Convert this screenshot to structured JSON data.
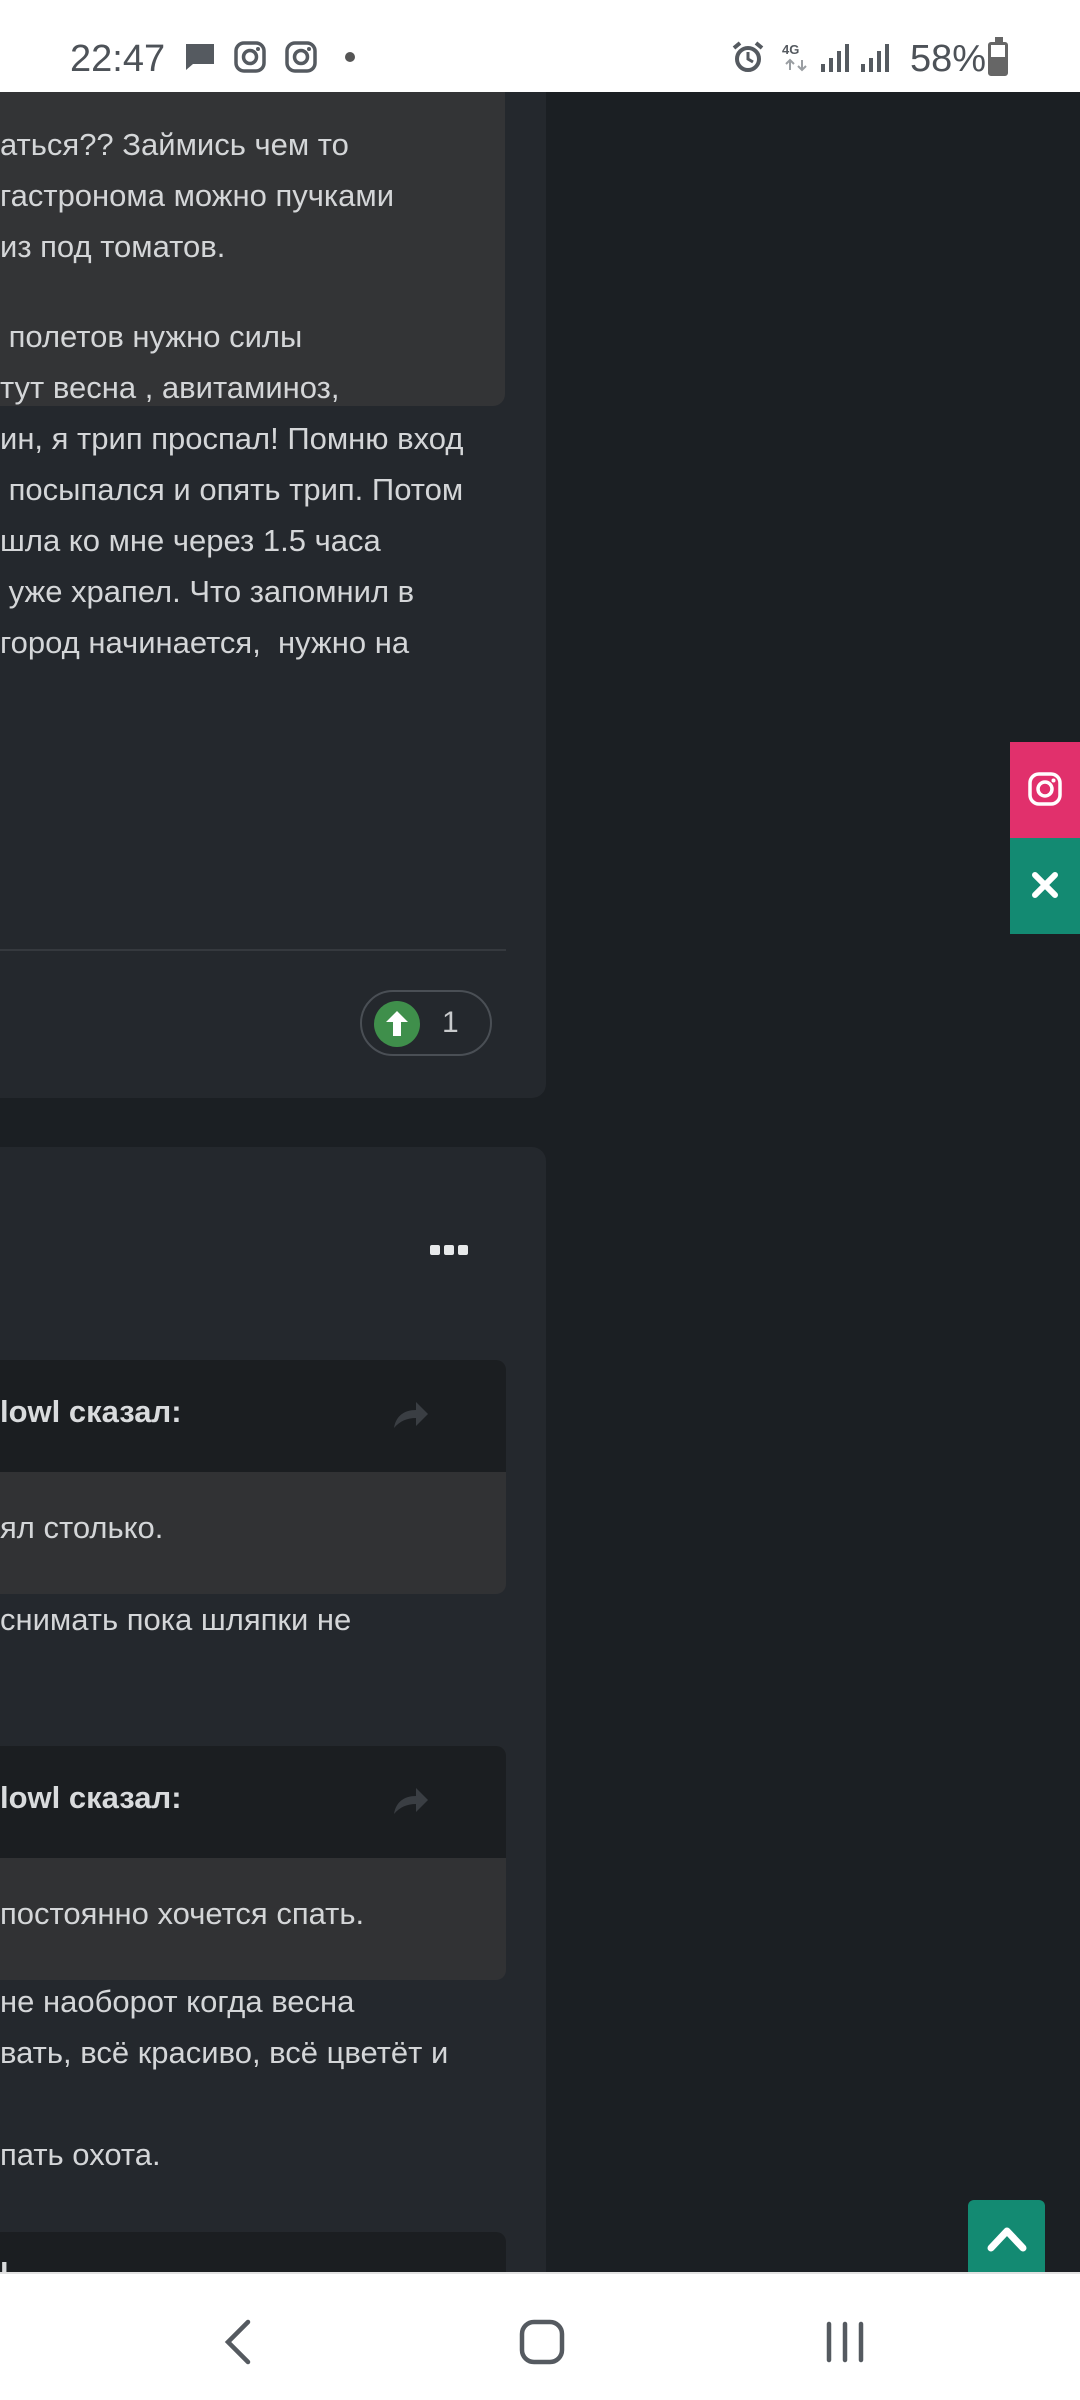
{
  "status_bar": {
    "time": "22:47",
    "icons": [
      "message-icon",
      "instagram-icon",
      "instagram-icon",
      "dot-icon"
    ],
    "right_icons": [
      "alarm-icon",
      "4g-icon",
      "signal-icon",
      "signal-icon"
    ],
    "battery_percent": "58%",
    "battery_level": 0.58
  },
  "post1": {
    "quote_lines": [
      "аться?? Займись чем то",
      "гастронома можно пучками",
      "из под томатов."
    ],
    "body_lines": [
      " полетов нужно силы",
      "тут весна , авитаминоз,",
      "ин, я трип проспал! Помню вход",
      " посыпался и опять трип. Потом",
      "шла ко мне через 1.5 часа",
      " уже храпел. Что запомнил в",
      "город начинается,  нужно на"
    ],
    "like_count": "1"
  },
  "post2": {
    "quote1_header": "lowl сказал:",
    "quote1_body": "ял столько.",
    "reply1_line": "снимать пока шляпки не",
    "quote2_header": "lowl сказал:",
    "quote2_body": "постоянно хочется спать.",
    "reply2_lines": [
      "не наоборот когда весна",
      "вать, всё красиво, всё цветёт и",
      "",
      "пать охота."
    ],
    "bottom_header": "l"
  },
  "floating": {
    "instagram_color": "#e1306c",
    "close_color": "#138a72"
  },
  "nav": {
    "buttons": [
      "back-icon",
      "home-icon",
      "recents-icon"
    ]
  }
}
